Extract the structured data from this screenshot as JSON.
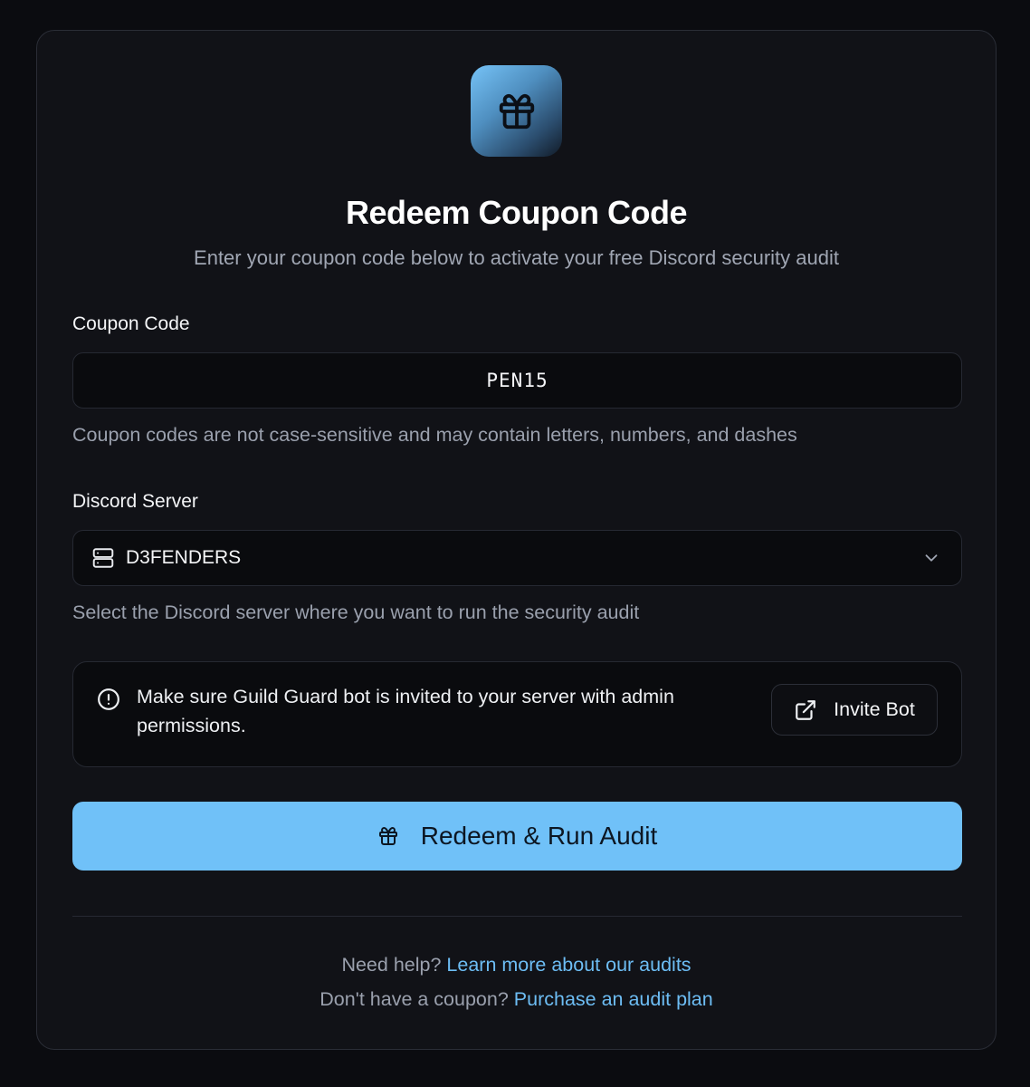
{
  "header": {
    "icon": "gift-icon",
    "title": "Redeem Coupon Code",
    "subtitle": "Enter your coupon code below to activate your free Discord security audit"
  },
  "coupon": {
    "label": "Coupon Code",
    "value": "PEN15",
    "hint": "Coupon codes are not case-sensitive and may contain letters, numbers, and dashes"
  },
  "server": {
    "label": "Discord Server",
    "icon": "server-icon",
    "selected": "D3FENDERS",
    "hint": "Select the Discord server where you want to run the security audit"
  },
  "notice": {
    "icon": "alert-circle-icon",
    "text": "Make sure Guild Guard bot is invited to your server with admin permissions.",
    "button_label": "Invite Bot",
    "button_icon": "external-link-icon"
  },
  "primary_action": {
    "icon": "gift-icon",
    "label": "Redeem & Run Audit"
  },
  "footer": {
    "help_prefix": "Need help?",
    "help_link": "Learn more about our audits",
    "coupon_prefix": "Don't have a coupon?",
    "coupon_link": "Purchase an audit plan"
  },
  "colors": {
    "background": "#0b0c10",
    "card": "#111217",
    "accent": "#70c1f8",
    "link": "#6dbdf4",
    "muted_text": "#9aa0ad"
  }
}
